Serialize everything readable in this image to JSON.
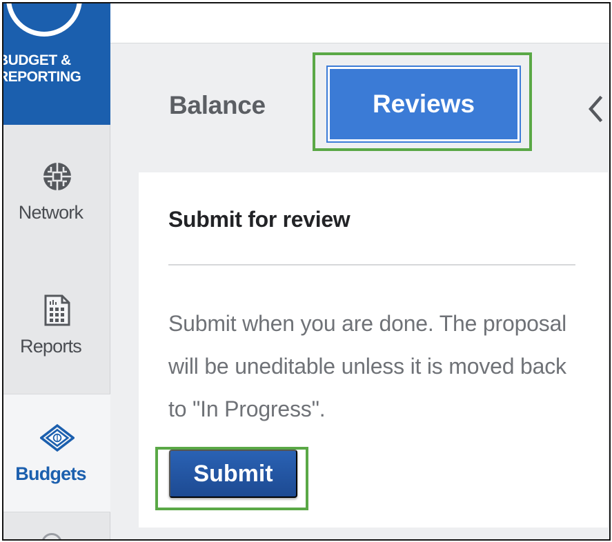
{
  "product": {
    "name": "BUDGET &\nREPORTING"
  },
  "nav": {
    "items": [
      {
        "label": "Network",
        "icon": "network-globe-icon"
      },
      {
        "label": "Reports",
        "icon": "report-document-icon"
      },
      {
        "label": "Budgets",
        "icon": "budget-diamond-icon",
        "active": true
      }
    ]
  },
  "tabs": [
    {
      "label": "Balance",
      "active": false
    },
    {
      "label": "Reviews",
      "active": true
    }
  ],
  "collapse_icon": "chevron-left-icon",
  "review_panel": {
    "title": "Submit for review",
    "description": "Submit when you are done. The proposal will be uneditable unless it is moved back to \"In Progress\".",
    "submit_label": "Submit"
  },
  "colors": {
    "brand_blue": "#1b5fae",
    "tab_active": "#3b7bd6",
    "highlight_green": "#5aa846",
    "submit_blue": "#1d4a92"
  }
}
